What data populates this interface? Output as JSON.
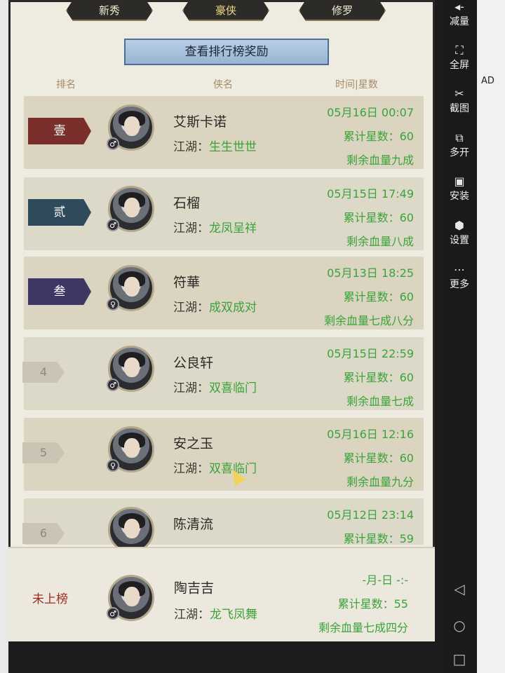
{
  "tabs": [
    "新秀",
    "豪侠",
    "修罗"
  ],
  "reward_button": "查看排行榜奖励",
  "columns": {
    "rank": "排名",
    "hero": "侠名",
    "time": "时间|星数"
  },
  "rows": [
    {
      "rank": "壹",
      "rank_color": "#7b2f2c",
      "name": "艾斯卡诺",
      "jianghu_label": "江湖：",
      "jianghu": "生生世世",
      "time": "05月16日 00:07",
      "stars": "累计星数：60",
      "hp": "剩余血量九成",
      "gender": "♂"
    },
    {
      "rank": "贰",
      "rank_color": "#2f4a5a",
      "name": "石榴",
      "jianghu_label": "江湖：",
      "jianghu": "龙凤呈祥",
      "time": "05月15日 17:49",
      "stars": "累计星数：60",
      "hp": "剩余血量八成",
      "gender": "♂"
    },
    {
      "rank": "叁",
      "rank_color": "#3f3763",
      "name": "符華",
      "jianghu_label": "江湖：",
      "jianghu": "成双成对",
      "time": "05月13日 18:25",
      "stars": "累计星数：60",
      "hp": "剩余血量七成八分",
      "gender": "♀"
    },
    {
      "rank": "4",
      "name": "公良轩",
      "jianghu_label": "江湖：",
      "jianghu": "双喜临门",
      "time": "05月15日 22:59",
      "stars": "累计星数：60",
      "hp": "剩余血量七成",
      "gender": "♂"
    },
    {
      "rank": "5",
      "name": "安之玉",
      "jianghu_label": "江湖：",
      "jianghu": "双喜临门",
      "time": "05月16日 12:16",
      "stars": "累计星数：60",
      "hp": "剩余血量九分",
      "gender": "♀"
    },
    {
      "rank": "6",
      "name": "陈清流",
      "time": "05月12日 23:14",
      "stars": "累计星数：59"
    }
  ],
  "me": {
    "rank": "未上榜",
    "name": "陶吉吉",
    "jianghu_label": "江湖：",
    "jianghu": "龙飞凤舞",
    "time": "-月-日 -:-",
    "stars": "累计星数：55",
    "hp": "剩余血量七成四分",
    "gender": "♂"
  },
  "toolbar": [
    {
      "icon": "volume-down-icon",
      "glyph": "◂-",
      "label": "减量"
    },
    {
      "icon": "fullscreen-icon",
      "glyph": "⛶",
      "label": "全屏"
    },
    {
      "icon": "scissors-icon",
      "glyph": "✂",
      "label": "截图"
    },
    {
      "icon": "multi-open-icon",
      "glyph": "⧉",
      "label": "多开"
    },
    {
      "icon": "apk-icon",
      "glyph": "▣",
      "label": "安装"
    },
    {
      "icon": "settings-icon",
      "glyph": "⬢",
      "label": "设置"
    },
    {
      "icon": "more-icon",
      "glyph": "⋯",
      "label": "更多"
    }
  ],
  "right_strip_text": "AD"
}
